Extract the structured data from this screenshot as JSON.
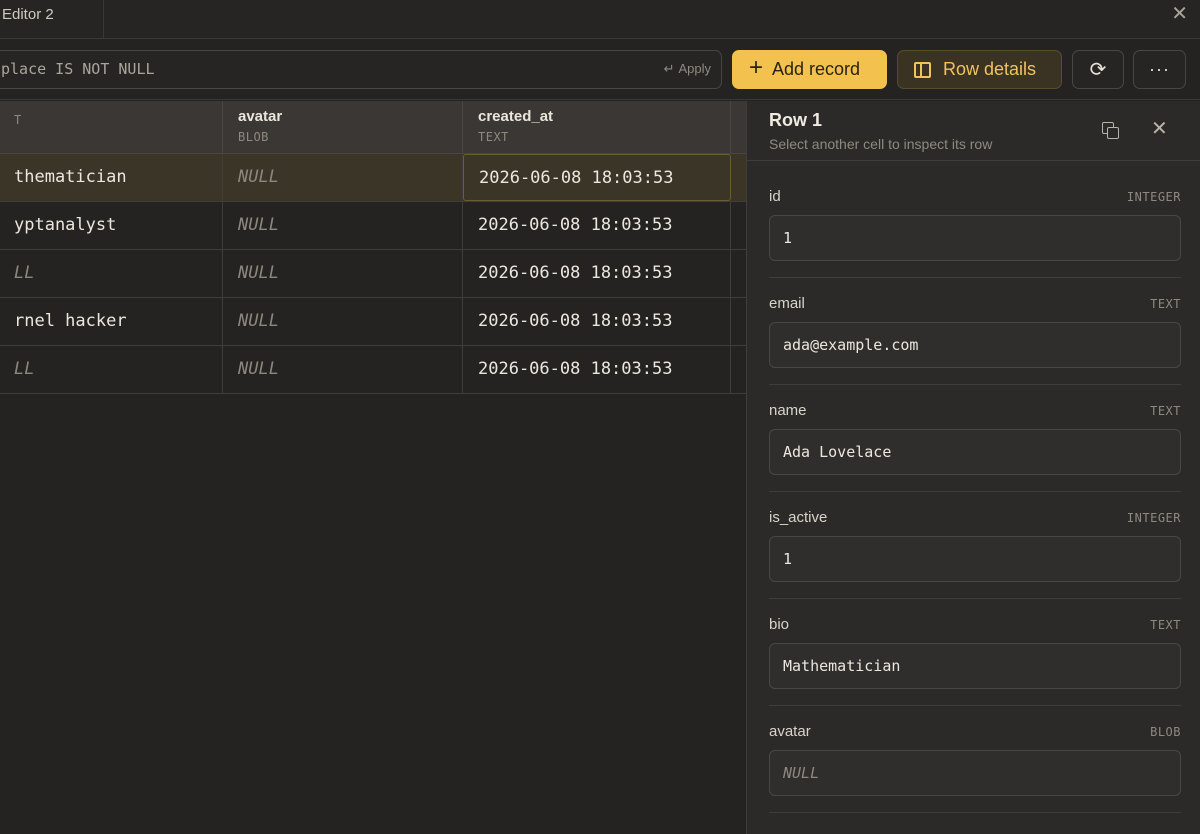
{
  "tab": {
    "title": "Editor 2"
  },
  "toolbar": {
    "filter_value": "place IS NOT NULL",
    "apply_icon": "↵",
    "apply_label": "Apply",
    "add_label": "Add record",
    "add_icon": "+",
    "details_label": "Row details",
    "refresh_icon": "⟳",
    "more_icon": "···"
  },
  "grid": {
    "columns": [
      {
        "name": "",
        "type": "T"
      },
      {
        "name": "avatar",
        "type": "BLOB"
      },
      {
        "name": "created_at",
        "type": "TEXT"
      }
    ],
    "rows": [
      {
        "c1": "thematician",
        "c2": "NULL",
        "c3": "2026-06-08 18:03:53"
      },
      {
        "c1": "yptanalyst",
        "c2": "NULL",
        "c3": "2026-06-08 18:03:53"
      },
      {
        "c1": "LL",
        "c2": "NULL",
        "c3": "2026-06-08 18:03:53"
      },
      {
        "c1": "rnel hacker",
        "c2": "NULL",
        "c3": "2026-06-08 18:03:53"
      },
      {
        "c1": "LL",
        "c2": "NULL",
        "c3": "2026-06-08 18:03:53"
      }
    ]
  },
  "inspector": {
    "title": "Row 1",
    "subtitle": "Select another cell to inspect its row",
    "close_icon": "✕",
    "fields": [
      {
        "label": "id",
        "type": "INTEGER",
        "value": "1"
      },
      {
        "label": "email",
        "type": "TEXT",
        "value": "ada@example.com"
      },
      {
        "label": "name",
        "type": "TEXT",
        "value": "Ada Lovelace"
      },
      {
        "label": "is_active",
        "type": "INTEGER",
        "value": "1"
      },
      {
        "label": "bio",
        "type": "TEXT",
        "value": "Mathematician"
      },
      {
        "label": "avatar",
        "type": "BLOB",
        "value": "NULL"
      }
    ]
  },
  "window": {
    "close_icon": "✕"
  }
}
